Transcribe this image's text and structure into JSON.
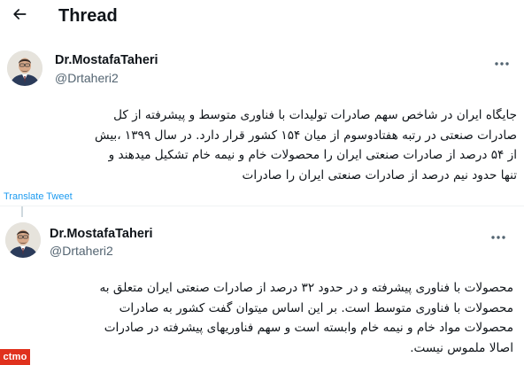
{
  "header": {
    "back_icon": "arrow-left-icon",
    "title": "Thread"
  },
  "tweets": [
    {
      "author_name": "Dr.MostafaTaheri",
      "handle": "@Drtaheri2",
      "more_icon": "more-horizontal-icon",
      "lines": [
        "جایگاه ایران در شاخص سهم صادرات تولیدات با فناوری متوسط و پیشرفته از کل",
        "صادرات صنعتی در رتبه هفتادوسوم از میان ۱۵۴ کشور قرار دارد. در سال ۱۳۹۹ ،بیش",
        "از ۵۴ درصد از صادرات صنعتی ایران را محصولات خام و نیمه خام تشکیل میدهند و",
        "تنها حدود نیم درصد از صادرات صنعتی ایران را صادرات"
      ],
      "translate_label": "Translate Tweet"
    },
    {
      "author_name": "Dr.MostafaTaheri",
      "handle": "@Drtaheri2",
      "more_icon": "more-horizontal-icon",
      "lines": [
        "محصولات با فناوری پیشرفته و در حدود ۳۲ درصد از صادرات صنعتی ایران متعلق به",
        "محصولات با فناوری متوسط است. بر این اساس میتوان گفت کشور به صادرات",
        "محصولات مواد خام و نیمه خام وابسته است و سهم فناوریهای پیشرفته در صادرات",
        "اصالا ملموس نیست."
      ]
    }
  ],
  "watermark": {
    "text": "ctmo",
    "color": "#e0311d"
  },
  "colors": {
    "text": "#0f1419",
    "secondary": "#536471",
    "link": "#1d9bf0"
  }
}
